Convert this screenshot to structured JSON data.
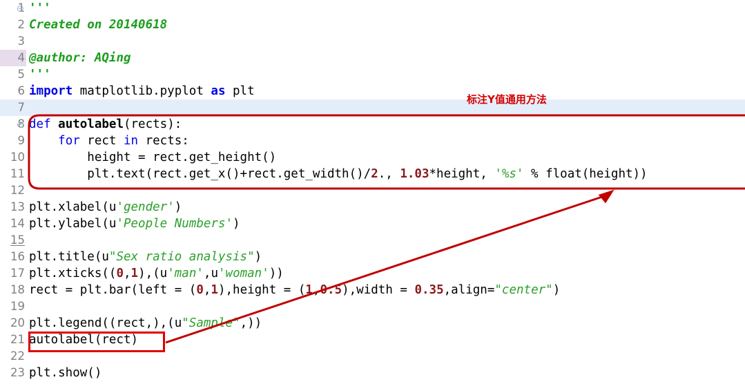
{
  "editor": {
    "title": "python-source-editor",
    "language": "Python",
    "colors": {
      "background": "#ffffff",
      "keyword": "#0000e6",
      "string": "#2ca02c",
      "docstring": "#1c9e1c",
      "number": "#8b1a1a",
      "function": "#000000",
      "gutter_text": "#808080",
      "current_line_highlight": "#e4eefb",
      "gutter_line_highlight": "#e6dcec",
      "annotation_red": "#d40000"
    },
    "gutter": {
      "highlighted_line": 4,
      "underlined_line": 15,
      "fold_marker_lines": [
        1,
        8
      ]
    },
    "row_highlight_lines": [
      7
    ],
    "lines": [
      {
        "n": "1",
        "tokens": [
          {
            "t": "'''",
            "c": "doc"
          }
        ]
      },
      {
        "n": "2",
        "tokens": [
          {
            "t": "Created on 20140618",
            "c": "doc"
          }
        ]
      },
      {
        "n": "3",
        "tokens": [
          {
            "t": "",
            "c": "pl"
          }
        ]
      },
      {
        "n": "4",
        "tokens": [
          {
            "t": "@author:",
            "c": "doc"
          },
          {
            "t": " ",
            "c": "pl"
          },
          {
            "t": "AQing",
            "c": "doc"
          }
        ]
      },
      {
        "n": "5",
        "tokens": [
          {
            "t": "'''",
            "c": "doc"
          }
        ]
      },
      {
        "n": "6",
        "tokens": [
          {
            "t": "import",
            "c": "kw-b"
          },
          {
            "t": " matplotlib.pyplot ",
            "c": "pl"
          },
          {
            "t": "as",
            "c": "kw-b"
          },
          {
            "t": " plt",
            "c": "pl"
          }
        ]
      },
      {
        "n": "7",
        "tokens": [
          {
            "t": "",
            "c": "pl"
          }
        ]
      },
      {
        "n": "8",
        "tokens": [
          {
            "t": "def",
            "c": "kw"
          },
          {
            "t": " ",
            "c": "pl"
          },
          {
            "t": "autolabel",
            "c": "fn"
          },
          {
            "t": "(rects):",
            "c": "pl"
          }
        ]
      },
      {
        "n": "9",
        "tokens": [
          {
            "t": "    ",
            "c": "pl"
          },
          {
            "t": "for",
            "c": "kw"
          },
          {
            "t": " rect ",
            "c": "pl"
          },
          {
            "t": "in",
            "c": "kw"
          },
          {
            "t": " rects:",
            "c": "pl"
          }
        ]
      },
      {
        "n": "10",
        "tokens": [
          {
            "t": "        height = rect.get_height()",
            "c": "pl"
          }
        ]
      },
      {
        "n": "11",
        "tokens": [
          {
            "t": "        plt.text(rect.get_x()+rect.get_width()/",
            "c": "pl"
          },
          {
            "t": "2",
            "c": "num"
          },
          {
            "t": "., ",
            "c": "pl"
          },
          {
            "t": "1.03",
            "c": "num"
          },
          {
            "t": "*height, ",
            "c": "pl"
          },
          {
            "t": "'%s'",
            "c": "str"
          },
          {
            "t": " % float(height))",
            "c": "pl"
          }
        ]
      },
      {
        "n": "12",
        "tokens": [
          {
            "t": "",
            "c": "pl"
          }
        ]
      },
      {
        "n": "13",
        "tokens": [
          {
            "t": "plt.xlabel(u",
            "c": "pl"
          },
          {
            "t": "'gender'",
            "c": "str"
          },
          {
            "t": ")",
            "c": "pl"
          }
        ]
      },
      {
        "n": "14",
        "tokens": [
          {
            "t": "plt.ylabel(u",
            "c": "pl"
          },
          {
            "t": "'People Numbers'",
            "c": "str"
          },
          {
            "t": ")",
            "c": "pl"
          }
        ]
      },
      {
        "n": "15",
        "tokens": [
          {
            "t": "",
            "c": "pl"
          }
        ]
      },
      {
        "n": "16",
        "tokens": [
          {
            "t": "plt.title(u",
            "c": "pl"
          },
          {
            "t": "\"Sex ratio analysis\"",
            "c": "str"
          },
          {
            "t": ")",
            "c": "pl"
          }
        ]
      },
      {
        "n": "17",
        "tokens": [
          {
            "t": "plt.xticks((",
            "c": "pl"
          },
          {
            "t": "0",
            "c": "num"
          },
          {
            "t": ",",
            "c": "pl"
          },
          {
            "t": "1",
            "c": "num"
          },
          {
            "t": "),(u",
            "c": "pl"
          },
          {
            "t": "'man'",
            "c": "str"
          },
          {
            "t": ",u",
            "c": "pl"
          },
          {
            "t": "'woman'",
            "c": "str"
          },
          {
            "t": "))",
            "c": "pl"
          }
        ]
      },
      {
        "n": "18",
        "tokens": [
          {
            "t": "rect = plt.bar(left = (",
            "c": "pl"
          },
          {
            "t": "0",
            "c": "num"
          },
          {
            "t": ",",
            "c": "pl"
          },
          {
            "t": "1",
            "c": "num"
          },
          {
            "t": "),height = (",
            "c": "pl"
          },
          {
            "t": "1",
            "c": "num"
          },
          {
            "t": ",",
            "c": "pl"
          },
          {
            "t": "0.5",
            "c": "num"
          },
          {
            "t": "),width = ",
            "c": "pl"
          },
          {
            "t": "0.35",
            "c": "num"
          },
          {
            "t": ",align=",
            "c": "pl"
          },
          {
            "t": "\"center\"",
            "c": "str"
          },
          {
            "t": ")",
            "c": "pl"
          }
        ]
      },
      {
        "n": "19",
        "tokens": [
          {
            "t": "",
            "c": "pl"
          }
        ]
      },
      {
        "n": "20",
        "tokens": [
          {
            "t": "plt.legend((rect,),(u",
            "c": "pl"
          },
          {
            "t": "\"Sample\"",
            "c": "str"
          },
          {
            "t": ",))",
            "c": "pl"
          }
        ]
      },
      {
        "n": "21",
        "tokens": [
          {
            "t": "autolabel(rect)",
            "c": "pl"
          }
        ]
      },
      {
        "n": "22",
        "tokens": [
          {
            "t": "",
            "c": "pl"
          }
        ]
      },
      {
        "n": "23",
        "tokens": [
          {
            "t": "plt.show()",
            "c": "pl"
          }
        ]
      }
    ]
  },
  "annotations": {
    "caption": "标注Y值通用方法",
    "caption_color": "#d40000",
    "rounded_box_label": "highlight-autolabel-function-body",
    "small_box_label": "highlight-autolabel-call",
    "arrow_label": "arrow-call-to-definition"
  }
}
